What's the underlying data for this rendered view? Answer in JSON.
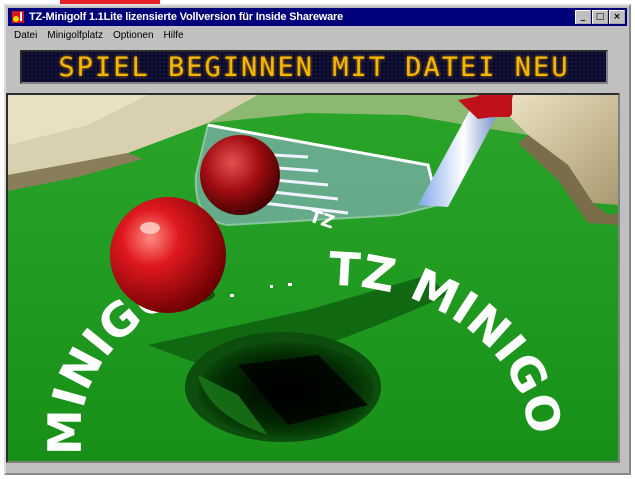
{
  "window": {
    "title": "TZ-Minigolf 1.1Lite lizensierte Vollversion für Inside Shareware",
    "buttons": {
      "minimize": "_",
      "maximize": "□",
      "close": "×"
    }
  },
  "menu": {
    "items": [
      "Datei",
      "Minigolfplatz",
      "Optionen",
      "Hilfe"
    ]
  },
  "display": {
    "message": "SPIEL BEGINNEN MIT DATEI NEU"
  },
  "scene": {
    "logo_text_arc_left": "MINIGO",
    "logo_text_arc_right": "TZ MINIGO",
    "club_text": "TZ",
    "colors": {
      "felt": "#1f9a1f",
      "ball": "#d8151a",
      "led": "#f5b800"
    }
  },
  "colors": {
    "titlebar": "#00007b",
    "window": "#c0c0c0"
  }
}
